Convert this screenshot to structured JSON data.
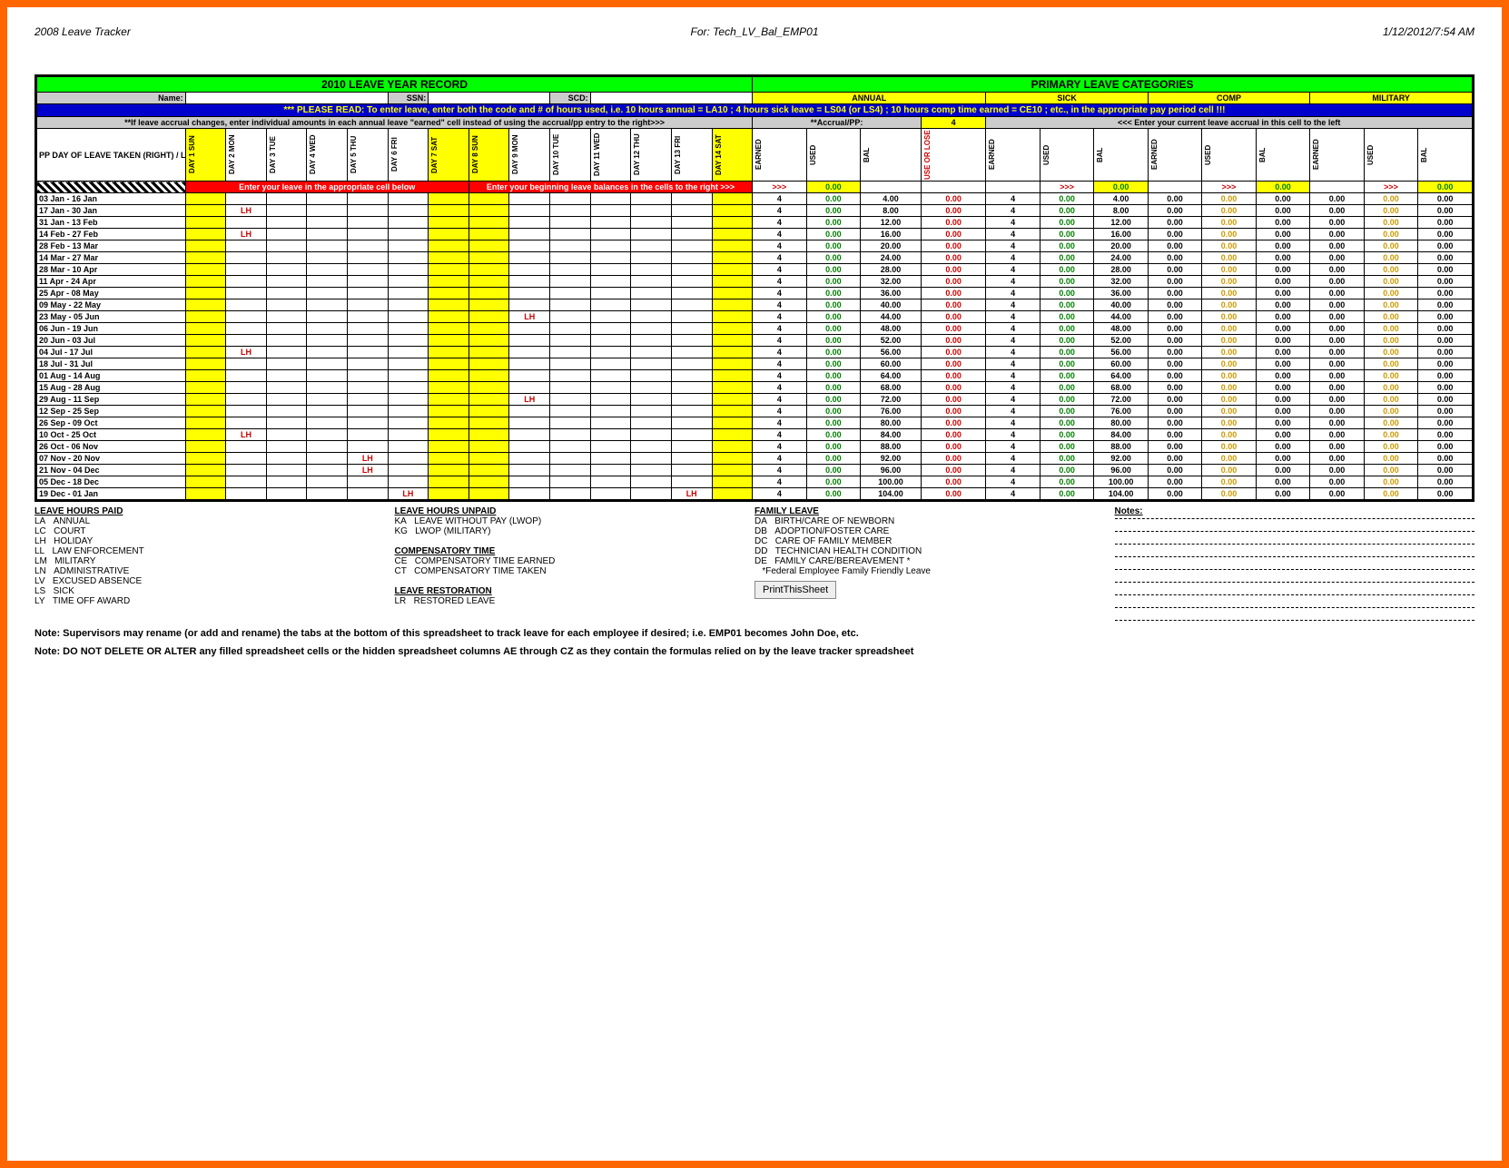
{
  "hdr": {
    "l": "2008 Leave Tracker",
    "c": "For: Tech_LV_Bal_EMP01",
    "r": "1/12/2012/7:54 AM"
  },
  "titleL": "2010 LEAVE YEAR RECORD",
  "titleR": "PRIMARY LEAVE CATEGORIES",
  "lbl": {
    "name": "Name:",
    "ssn": "SSN:",
    "scd": "SCD:"
  },
  "cats": [
    "ANNUAL",
    "SICK",
    "COMP",
    "MILITARY"
  ],
  "blue": "*** PLEASE READ: To enter leave, enter both the code and # of hours used, i.e. 10 hours annual = LA10 ; 4 hours sick leave = LS04 (or LS4) ; 10 hours comp time earned = CE10 ; etc., in the appropriate pay period cell !!!",
  "gray1": "**If leave accrual changes, enter individual amounts in each  annual leave \"earned\" cell instead of using the accrual/pp entry to the right>>>",
  "gray2": "**Accrual/PP:",
  "grayN": "4",
  "gray3": "<<< Enter your current leave accrual in this cell to the left",
  "rowH": "PP DAY OF LEAVE TAKEN (RIGHT) / LEAVE PERIOD (BELOW)",
  "days": [
    "DAY 1 SUN",
    "DAY 2 MON",
    "DAY 3 TUE",
    "DAY 4 WED",
    "DAY 5 THU",
    "DAY 6 FRI",
    "DAY 7 SAT",
    "DAY 8 SUN",
    "DAY 9 MON",
    "DAY 10 TUE",
    "DAY 11 WED",
    "DAY 12 THU",
    "DAY 13 FRI",
    "DAY 14 SAT"
  ],
  "catH": [
    "EARNED",
    "USED",
    "BAL",
    "USE OR LOSE",
    "EARNED",
    "USED",
    "BAL",
    "EARNED",
    "USED",
    "BAL",
    "EARNED",
    "USED",
    "BAL"
  ],
  "redL": "Enter your leave in the appropriate cell below",
  "redR": "Enter your beginning leave balances in the cells to the right >>>",
  "initRow": [
    ">>>",
    "0.00",
    "",
    "",
    "",
    ">>>",
    "0.00",
    "",
    ">>>",
    "0.00",
    "",
    ">>>",
    "0.00"
  ],
  "rows": [
    {
      "p": "03 Jan - 16 Jan",
      "lh": [],
      "a": {
        "e": "4",
        "u": "0.00",
        "b": "4.00",
        "ul": "0.00"
      },
      "s": {
        "e": "4",
        "u": "0.00",
        "b": "4.00"
      },
      "c": {
        "e": "0.00",
        "u": "0.00",
        "b": "0.00"
      },
      "m": {
        "e": "0.00",
        "u": "0.00",
        "b": "0.00"
      }
    },
    {
      "p": "17 Jan - 30 Jan",
      "lh": [
        1
      ],
      "a": {
        "e": "4",
        "u": "0.00",
        "b": "8.00",
        "ul": "0.00"
      },
      "s": {
        "e": "4",
        "u": "0.00",
        "b": "8.00"
      },
      "c": {
        "e": "0.00",
        "u": "0.00",
        "b": "0.00"
      },
      "m": {
        "e": "0.00",
        "u": "0.00",
        "b": "0.00"
      }
    },
    {
      "p": "31 Jan - 13 Feb",
      "lh": [],
      "a": {
        "e": "4",
        "u": "0.00",
        "b": "12.00",
        "ul": "0.00"
      },
      "s": {
        "e": "4",
        "u": "0.00",
        "b": "12.00"
      },
      "c": {
        "e": "0.00",
        "u": "0.00",
        "b": "0.00"
      },
      "m": {
        "e": "0.00",
        "u": "0.00",
        "b": "0.00"
      }
    },
    {
      "p": "14 Feb - 27 Feb",
      "lh": [
        1
      ],
      "a": {
        "e": "4",
        "u": "0.00",
        "b": "16.00",
        "ul": "0.00"
      },
      "s": {
        "e": "4",
        "u": "0.00",
        "b": "16.00"
      },
      "c": {
        "e": "0.00",
        "u": "0.00",
        "b": "0.00"
      },
      "m": {
        "e": "0.00",
        "u": "0.00",
        "b": "0.00"
      }
    },
    {
      "p": "28 Feb - 13 Mar",
      "lh": [],
      "a": {
        "e": "4",
        "u": "0.00",
        "b": "20.00",
        "ul": "0.00"
      },
      "s": {
        "e": "4",
        "u": "0.00",
        "b": "20.00"
      },
      "c": {
        "e": "0.00",
        "u": "0.00",
        "b": "0.00"
      },
      "m": {
        "e": "0.00",
        "u": "0.00",
        "b": "0.00"
      }
    },
    {
      "p": "14 Mar - 27 Mar",
      "lh": [],
      "a": {
        "e": "4",
        "u": "0.00",
        "b": "24.00",
        "ul": "0.00"
      },
      "s": {
        "e": "4",
        "u": "0.00",
        "b": "24.00"
      },
      "c": {
        "e": "0.00",
        "u": "0.00",
        "b": "0.00"
      },
      "m": {
        "e": "0.00",
        "u": "0.00",
        "b": "0.00"
      }
    },
    {
      "p": "28 Mar - 10 Apr",
      "lh": [],
      "a": {
        "e": "4",
        "u": "0.00",
        "b": "28.00",
        "ul": "0.00"
      },
      "s": {
        "e": "4",
        "u": "0.00",
        "b": "28.00"
      },
      "c": {
        "e": "0.00",
        "u": "0.00",
        "b": "0.00"
      },
      "m": {
        "e": "0.00",
        "u": "0.00",
        "b": "0.00"
      }
    },
    {
      "p": "11 Apr - 24 Apr",
      "lh": [],
      "a": {
        "e": "4",
        "u": "0.00",
        "b": "32.00",
        "ul": "0.00"
      },
      "s": {
        "e": "4",
        "u": "0.00",
        "b": "32.00"
      },
      "c": {
        "e": "0.00",
        "u": "0.00",
        "b": "0.00"
      },
      "m": {
        "e": "0.00",
        "u": "0.00",
        "b": "0.00"
      }
    },
    {
      "p": "25 Apr - 08 May",
      "lh": [],
      "a": {
        "e": "4",
        "u": "0.00",
        "b": "36.00",
        "ul": "0.00"
      },
      "s": {
        "e": "4",
        "u": "0.00",
        "b": "36.00"
      },
      "c": {
        "e": "0.00",
        "u": "0.00",
        "b": "0.00"
      },
      "m": {
        "e": "0.00",
        "u": "0.00",
        "b": "0.00"
      }
    },
    {
      "p": "09 May - 22 May",
      "lh": [],
      "a": {
        "e": "4",
        "u": "0.00",
        "b": "40.00",
        "ul": "0.00"
      },
      "s": {
        "e": "4",
        "u": "0.00",
        "b": "40.00"
      },
      "c": {
        "e": "0.00",
        "u": "0.00",
        "b": "0.00"
      },
      "m": {
        "e": "0.00",
        "u": "0.00",
        "b": "0.00"
      }
    },
    {
      "p": "23 May - 05 Jun",
      "lh": [
        8
      ],
      "a": {
        "e": "4",
        "u": "0.00",
        "b": "44.00",
        "ul": "0.00"
      },
      "s": {
        "e": "4",
        "u": "0.00",
        "b": "44.00"
      },
      "c": {
        "e": "0.00",
        "u": "0.00",
        "b": "0.00"
      },
      "m": {
        "e": "0.00",
        "u": "0.00",
        "b": "0.00"
      }
    },
    {
      "p": "06 Jun - 19 Jun",
      "lh": [],
      "a": {
        "e": "4",
        "u": "0.00",
        "b": "48.00",
        "ul": "0.00"
      },
      "s": {
        "e": "4",
        "u": "0.00",
        "b": "48.00"
      },
      "c": {
        "e": "0.00",
        "u": "0.00",
        "b": "0.00"
      },
      "m": {
        "e": "0.00",
        "u": "0.00",
        "b": "0.00"
      }
    },
    {
      "p": "20 Jun - 03 Jul",
      "lh": [],
      "a": {
        "e": "4",
        "u": "0.00",
        "b": "52.00",
        "ul": "0.00"
      },
      "s": {
        "e": "4",
        "u": "0.00",
        "b": "52.00"
      },
      "c": {
        "e": "0.00",
        "u": "0.00",
        "b": "0.00"
      },
      "m": {
        "e": "0.00",
        "u": "0.00",
        "b": "0.00"
      }
    },
    {
      "p": "04 Jul - 17 Jul",
      "lh": [
        1
      ],
      "a": {
        "e": "4",
        "u": "0.00",
        "b": "56.00",
        "ul": "0.00"
      },
      "s": {
        "e": "4",
        "u": "0.00",
        "b": "56.00"
      },
      "c": {
        "e": "0.00",
        "u": "0.00",
        "b": "0.00"
      },
      "m": {
        "e": "0.00",
        "u": "0.00",
        "b": "0.00"
      }
    },
    {
      "p": "18 Jul - 31 Jul",
      "lh": [],
      "a": {
        "e": "4",
        "u": "0.00",
        "b": "60.00",
        "ul": "0.00"
      },
      "s": {
        "e": "4",
        "u": "0.00",
        "b": "60.00"
      },
      "c": {
        "e": "0.00",
        "u": "0.00",
        "b": "0.00"
      },
      "m": {
        "e": "0.00",
        "u": "0.00",
        "b": "0.00"
      }
    },
    {
      "p": "01 Aug - 14 Aug",
      "lh": [],
      "a": {
        "e": "4",
        "u": "0.00",
        "b": "64.00",
        "ul": "0.00"
      },
      "s": {
        "e": "4",
        "u": "0.00",
        "b": "64.00"
      },
      "c": {
        "e": "0.00",
        "u": "0.00",
        "b": "0.00"
      },
      "m": {
        "e": "0.00",
        "u": "0.00",
        "b": "0.00"
      }
    },
    {
      "p": "15 Aug - 28 Aug",
      "lh": [],
      "a": {
        "e": "4",
        "u": "0.00",
        "b": "68.00",
        "ul": "0.00"
      },
      "s": {
        "e": "4",
        "u": "0.00",
        "b": "68.00"
      },
      "c": {
        "e": "0.00",
        "u": "0.00",
        "b": "0.00"
      },
      "m": {
        "e": "0.00",
        "u": "0.00",
        "b": "0.00"
      }
    },
    {
      "p": "29 Aug - 11 Sep",
      "lh": [
        8
      ],
      "a": {
        "e": "4",
        "u": "0.00",
        "b": "72.00",
        "ul": "0.00"
      },
      "s": {
        "e": "4",
        "u": "0.00",
        "b": "72.00"
      },
      "c": {
        "e": "0.00",
        "u": "0.00",
        "b": "0.00"
      },
      "m": {
        "e": "0.00",
        "u": "0.00",
        "b": "0.00"
      }
    },
    {
      "p": "12 Sep - 25 Sep",
      "lh": [],
      "a": {
        "e": "4",
        "u": "0.00",
        "b": "76.00",
        "ul": "0.00"
      },
      "s": {
        "e": "4",
        "u": "0.00",
        "b": "76.00"
      },
      "c": {
        "e": "0.00",
        "u": "0.00",
        "b": "0.00"
      },
      "m": {
        "e": "0.00",
        "u": "0.00",
        "b": "0.00"
      }
    },
    {
      "p": "26 Sep - 09 Oct",
      "lh": [],
      "a": {
        "e": "4",
        "u": "0.00",
        "b": "80.00",
        "ul": "0.00"
      },
      "s": {
        "e": "4",
        "u": "0.00",
        "b": "80.00"
      },
      "c": {
        "e": "0.00",
        "u": "0.00",
        "b": "0.00"
      },
      "m": {
        "e": "0.00",
        "u": "0.00",
        "b": "0.00"
      }
    },
    {
      "p": "10 Oct - 25 Oct",
      "lh": [
        1
      ],
      "a": {
        "e": "4",
        "u": "0.00",
        "b": "84.00",
        "ul": "0.00"
      },
      "s": {
        "e": "4",
        "u": "0.00",
        "b": "84.00"
      },
      "c": {
        "e": "0.00",
        "u": "0.00",
        "b": "0.00"
      },
      "m": {
        "e": "0.00",
        "u": "0.00",
        "b": "0.00"
      }
    },
    {
      "p": "26 Oct - 06 Nov",
      "lh": [],
      "a": {
        "e": "4",
        "u": "0.00",
        "b": "88.00",
        "ul": "0.00"
      },
      "s": {
        "e": "4",
        "u": "0.00",
        "b": "88.00"
      },
      "c": {
        "e": "0.00",
        "u": "0.00",
        "b": "0.00"
      },
      "m": {
        "e": "0.00",
        "u": "0.00",
        "b": "0.00"
      }
    },
    {
      "p": "07 Nov - 20 Nov",
      "lh": [
        4
      ],
      "a": {
        "e": "4",
        "u": "0.00",
        "b": "92.00",
        "ul": "0.00"
      },
      "s": {
        "e": "4",
        "u": "0.00",
        "b": "92.00"
      },
      "c": {
        "e": "0.00",
        "u": "0.00",
        "b": "0.00"
      },
      "m": {
        "e": "0.00",
        "u": "0.00",
        "b": "0.00"
      }
    },
    {
      "p": "21 Nov - 04 Dec",
      "lh": [
        4
      ],
      "a": {
        "e": "4",
        "u": "0.00",
        "b": "96.00",
        "ul": "0.00"
      },
      "s": {
        "e": "4",
        "u": "0.00",
        "b": "96.00"
      },
      "c": {
        "e": "0.00",
        "u": "0.00",
        "b": "0.00"
      },
      "m": {
        "e": "0.00",
        "u": "0.00",
        "b": "0.00"
      }
    },
    {
      "p": "05 Dec - 18 Dec",
      "lh": [],
      "a": {
        "e": "4",
        "u": "0.00",
        "b": "100.00",
        "ul": "0.00"
      },
      "s": {
        "e": "4",
        "u": "0.00",
        "b": "100.00"
      },
      "c": {
        "e": "0.00",
        "u": "0.00",
        "b": "0.00"
      },
      "m": {
        "e": "0.00",
        "u": "0.00",
        "b": "0.00"
      }
    },
    {
      "p": "19 Dec - 01 Jan",
      "lh": [
        5,
        12
      ],
      "a": {
        "e": "4",
        "u": "0.00",
        "b": "104.00",
        "ul": "0.00"
      },
      "s": {
        "e": "4",
        "u": "0.00",
        "b": "104.00"
      },
      "c": {
        "e": "0.00",
        "u": "0.00",
        "b": "0.00"
      },
      "m": {
        "e": "0.00",
        "u": "0.00",
        "b": "0.00"
      }
    }
  ],
  "leg": {
    "paid": {
      "t": "LEAVE HOURS PAID",
      "i": [
        [
          "LA",
          "ANNUAL"
        ],
        [
          "LC",
          "COURT"
        ],
        [
          "LH",
          "HOLIDAY"
        ],
        [
          "LL",
          "LAW ENFORCEMENT"
        ],
        [
          "LM",
          "MILITARY"
        ],
        [
          "LN",
          "ADMINISTRATIVE"
        ],
        [
          "LV",
          "EXCUSED ABSENCE"
        ],
        [
          "LS",
          "SICK"
        ],
        [
          "LY",
          "TIME OFF AWARD"
        ]
      ]
    },
    "unpaid": {
      "t": "LEAVE HOURS UNPAID",
      "i": [
        [
          "KA",
          "LEAVE WITHOUT PAY (LWOP)"
        ],
        [
          "KG",
          "LWOP (MILITARY)"
        ]
      ]
    },
    "comp": {
      "t": "COMPENSATORY TIME",
      "i": [
        [
          "CE",
          "COMPENSATORY TIME EARNED"
        ],
        [
          "CT",
          "COMPENSATORY TIME TAKEN"
        ]
      ]
    },
    "rest": {
      "t": "LEAVE RESTORATION",
      "i": [
        [
          "LR",
          "RESTORED LEAVE"
        ]
      ]
    },
    "fam": {
      "t": "FAMILY LEAVE",
      "i": [
        [
          "DA",
          "BIRTH/CARE OF NEWBORN"
        ],
        [
          "DB",
          "ADOPTION/FOSTER CARE"
        ],
        [
          "DC",
          "CARE OF FAMILY MEMBER"
        ],
        [
          "DD",
          "TECHNICIAN HEALTH CONDITION"
        ],
        [
          "DE",
          "FAMILY CARE/BEREAVEMENT *"
        ],
        [
          "",
          "*Federal Employee Family Friendly Leave"
        ]
      ]
    },
    "notes": "Notes:",
    "btn": "PrintThisSheet"
  },
  "foot1": "Note:  Supervisors may rename (or add and rename) the tabs at the bottom of this spreadsheet to track leave for each employee if desired; i.e. EMP01 becomes John Doe, etc.",
  "foot2": "Note: DO NOT DELETE OR ALTER any filled spreadsheet cells or the hidden spreadsheet columns AE through CZ as they contain the formulas relied on by the leave tracker spreadsheet"
}
